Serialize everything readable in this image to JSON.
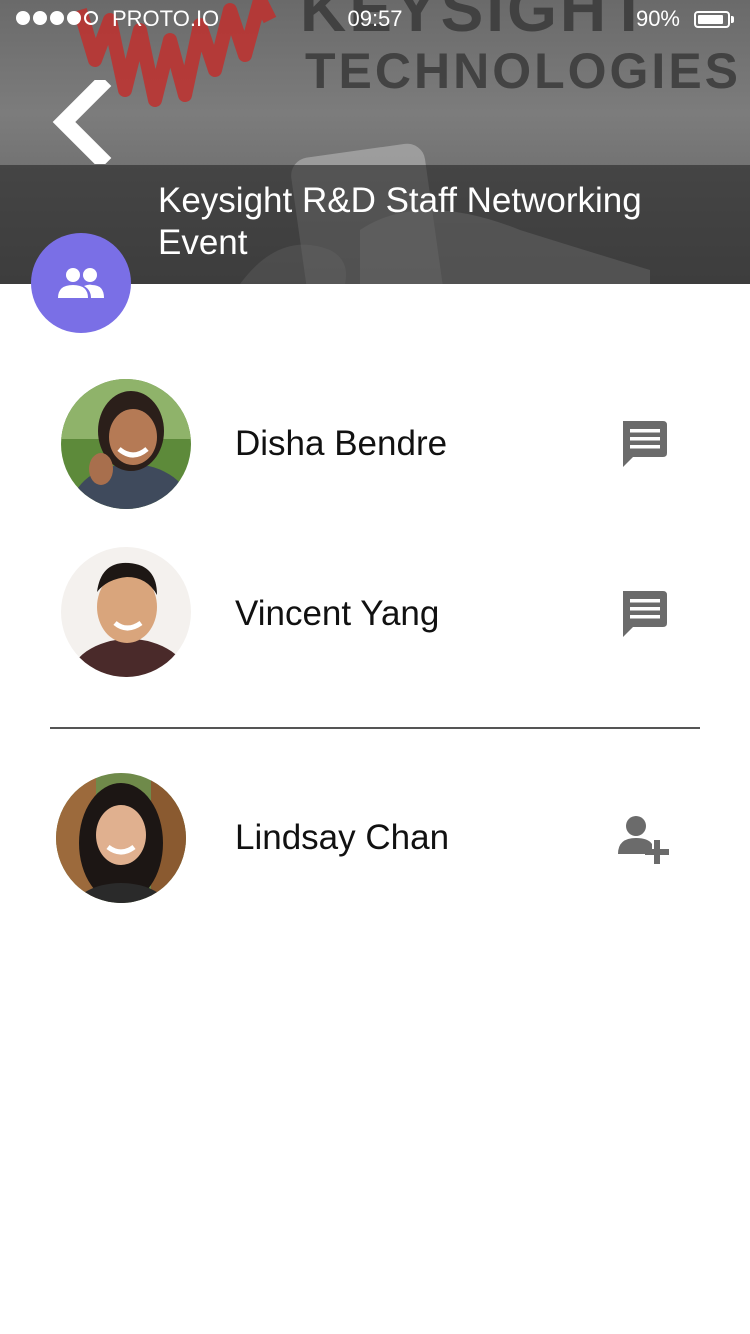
{
  "status_bar": {
    "carrier": "PROTO.IO",
    "time": "09:57",
    "battery_percent": "90%",
    "battery_level": 0.9,
    "signal_bars_filled": 4,
    "signal_bars_total": 5
  },
  "hero": {
    "brand_line_1": "KEYSIGHT",
    "brand_line_2": "TECHNOLOGIES"
  },
  "event": {
    "title": "Keysight R&D Staff Networking Event"
  },
  "colors": {
    "accent": "#7a6fe6",
    "icon_gray": "#6b6b6b"
  },
  "attendees": [
    {
      "name": "Disha Bendre",
      "action_icon": "message-icon"
    },
    {
      "name": "Vincent Yang",
      "action_icon": "message-icon"
    },
    {
      "name": "Lindsay Chan",
      "action_icon": "add-contact-icon"
    }
  ]
}
